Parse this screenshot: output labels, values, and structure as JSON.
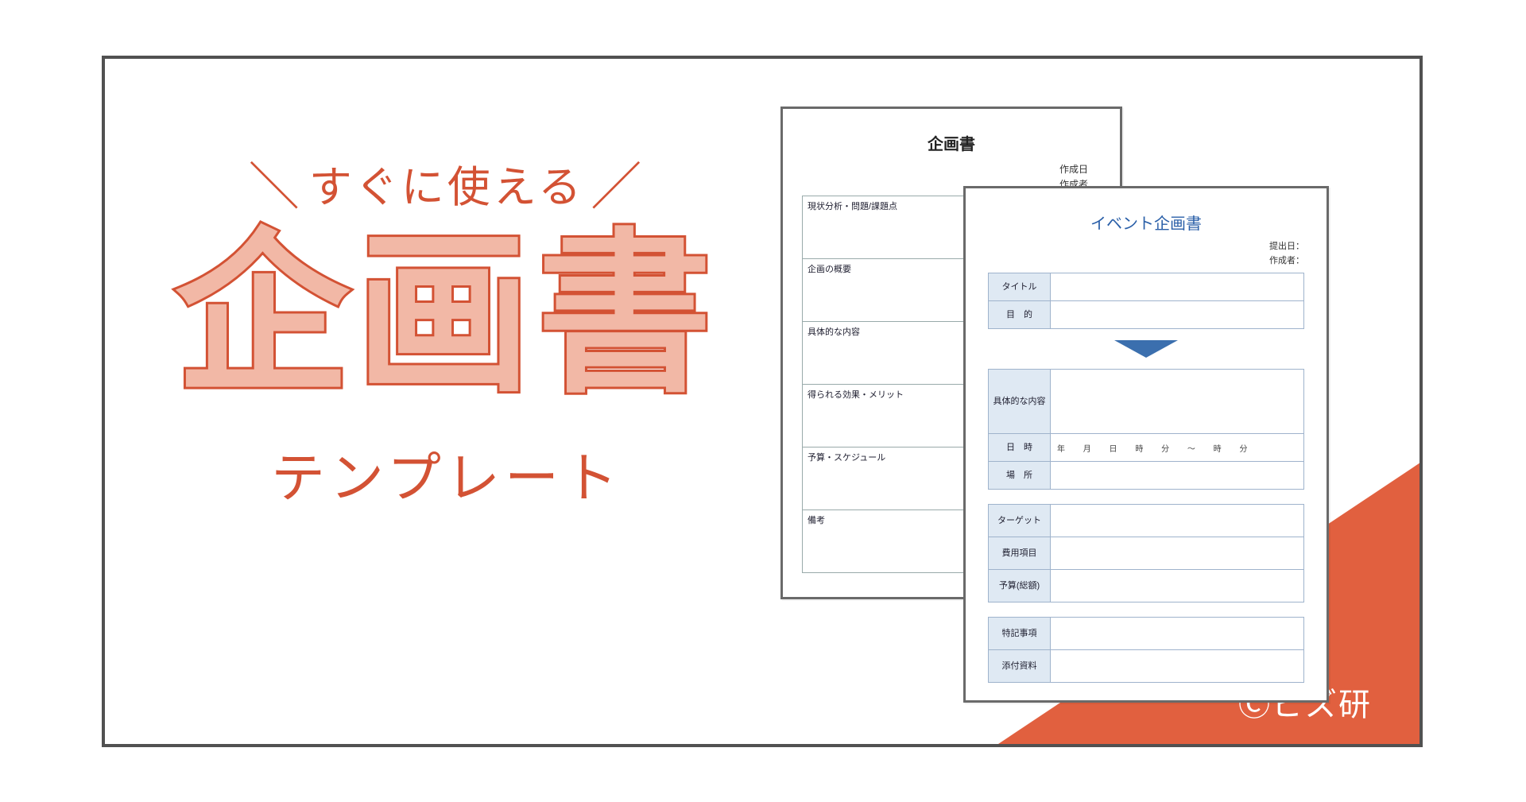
{
  "promo": {
    "tagline": "すぐに使える",
    "title": "企画書",
    "subtitle": "テンプレート"
  },
  "copyright": "Ⓒビズ研",
  "paper1": {
    "title": "企画書",
    "meta1": "作成日",
    "meta2": "作成者",
    "sections": [
      "現状分析・問題/課題点",
      "企画の概要",
      "具体的な内容",
      "得られる効果・メリット",
      "予算・スケジュール",
      "備考"
    ]
  },
  "paper2": {
    "title": "イベント企画書",
    "meta1": "提出日：",
    "meta2": "作成者：",
    "block1": [
      {
        "label": "タイトル"
      },
      {
        "label": "目　的"
      }
    ],
    "block2": [
      {
        "label": "具体的な内容",
        "tall": true
      },
      {
        "label": "日　時",
        "value": "年 月 日 時 分 ～ 時 分"
      },
      {
        "label": "場　所"
      }
    ],
    "block3": [
      {
        "label": "ターゲット"
      },
      {
        "label": "費用項目"
      },
      {
        "label": "予算(総額)"
      }
    ],
    "block4": [
      {
        "label": "特記事項"
      },
      {
        "label": "添付資料"
      }
    ]
  }
}
